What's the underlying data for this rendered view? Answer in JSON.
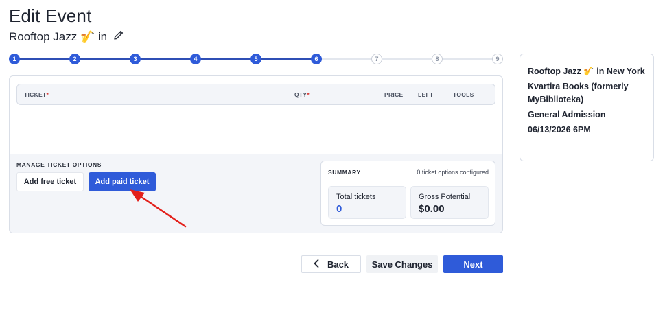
{
  "header": {
    "title": "Edit Event",
    "event_name": "Rooftop Jazz 🎷 in"
  },
  "stepper": {
    "steps": [
      {
        "label": "1",
        "state": "done"
      },
      {
        "label": "2",
        "state": "done"
      },
      {
        "label": "3",
        "state": "done"
      },
      {
        "label": "4",
        "state": "done"
      },
      {
        "label": "5",
        "state": "done"
      },
      {
        "label": "6",
        "state": "current"
      },
      {
        "label": "7",
        "state": "todo"
      },
      {
        "label": "8",
        "state": "todo"
      },
      {
        "label": "9",
        "state": "todo"
      }
    ]
  },
  "tickets_table": {
    "columns": {
      "ticket": "TICKET",
      "qty": "QTY",
      "price": "PRICE",
      "left": "LEFT",
      "tools": "TOOLS"
    },
    "required_marker": "*"
  },
  "manage": {
    "label": "MANAGE TICKET OPTIONS",
    "add_free": "Add free ticket",
    "add_paid": "Add paid ticket"
  },
  "summary": {
    "title": "SUMMARY",
    "configured": "0 ticket options configured",
    "total_tickets_label": "Total tickets",
    "total_tickets_value": "0",
    "gross_label": "Gross Potential",
    "gross_value": "$0.00"
  },
  "footer": {
    "back": "Back",
    "save": "Save Changes",
    "next": "Next"
  },
  "side_card": {
    "event_line": "Rooftop Jazz 🎷 in New York",
    "venue": "Kvartira Books (formerly MyBiblioteka)",
    "ticket_type": "General Admission",
    "datetime": "06/13/2026 6PM"
  },
  "colors": {
    "accent": "#2f5bd9",
    "annotation_arrow": "#e3201b"
  },
  "icons": {
    "edit": "pencil-icon",
    "back": "chevron-left-icon",
    "annotation": "red-arrow-icon"
  }
}
